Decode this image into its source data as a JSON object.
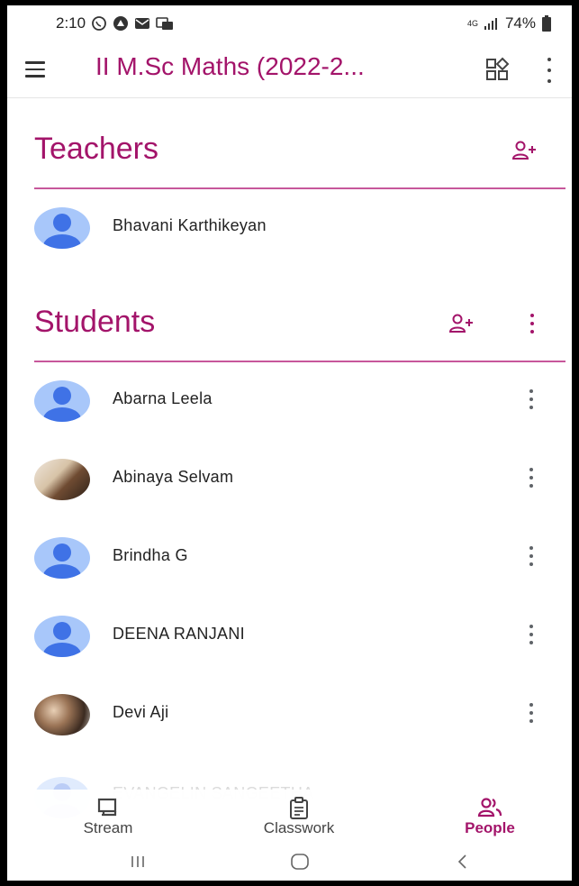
{
  "status_bar": {
    "time": "2:10",
    "network": "4G",
    "battery": "74%"
  },
  "app_bar": {
    "title": "II M.Sc Maths (2022-2..."
  },
  "teachers": {
    "heading": "Teachers",
    "people": [
      {
        "name": "Bhavani Karthikeyan",
        "avatar": "default"
      }
    ]
  },
  "students": {
    "heading": "Students",
    "people": [
      {
        "name": "Abarna Leela",
        "avatar": "default"
      },
      {
        "name": "Abinaya Selvam",
        "avatar": "photo"
      },
      {
        "name": "Brindha G",
        "avatar": "default"
      },
      {
        "name": "DEENA RANJANI",
        "avatar": "default"
      },
      {
        "name": "Devi Aji",
        "avatar": "photo"
      },
      {
        "name": "EVANGELIN SANGEETHA",
        "avatar": "default"
      }
    ]
  },
  "bottom_nav": {
    "stream": "Stream",
    "classwork": "Classwork",
    "people": "People"
  },
  "colors": {
    "accent": "#a3146a",
    "avatar_bg": "#a8c7fa",
    "avatar_fg": "#3f72e6"
  }
}
